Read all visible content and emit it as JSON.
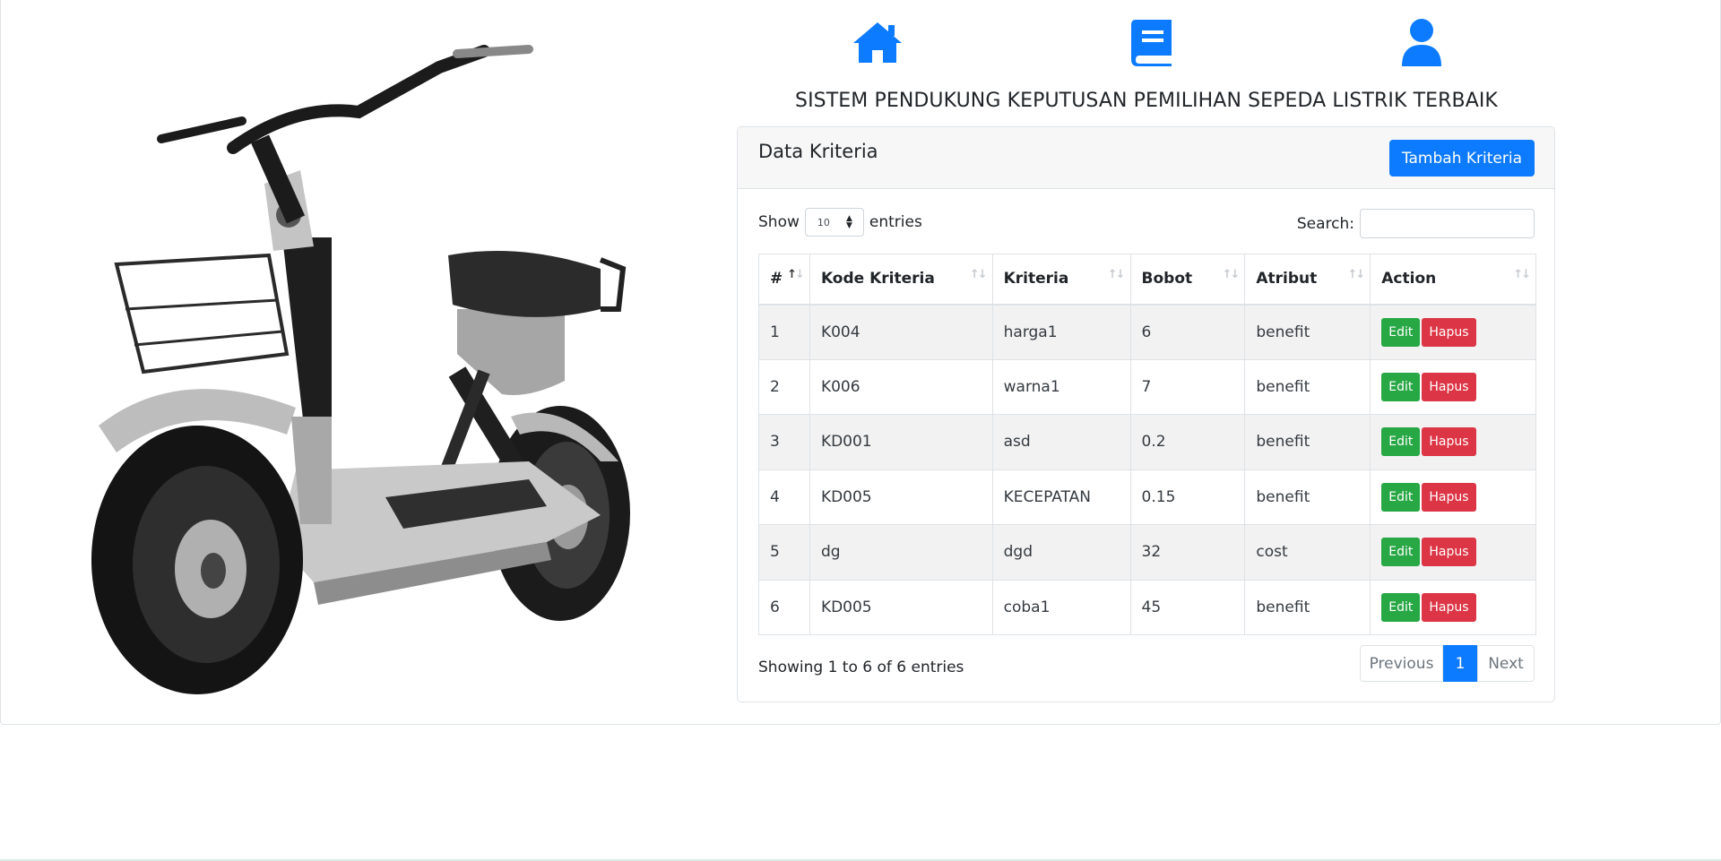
{
  "app": {
    "title": "SISTEM PENDUKUNG KEPUTUSAN PEMILIHAN SEPEDA LISTRIK TERBAIK"
  },
  "nav": [
    {
      "icon": "home-icon"
    },
    {
      "icon": "book-icon"
    },
    {
      "icon": "user-icon"
    }
  ],
  "card": {
    "title": "Data Kriteria",
    "add_button": "Tambah Kriteria"
  },
  "controls": {
    "show_label": "Show",
    "entries_value": "10",
    "entries_label": "entries",
    "search_label": "Search:",
    "search_value": ""
  },
  "table": {
    "headers": [
      "#",
      "Kode Kriteria",
      "Kriteria",
      "Bobot",
      "Atribut",
      "Action"
    ],
    "rows": [
      {
        "no": "1",
        "kode": "K004",
        "kriteria": "harga1",
        "bobot": "6",
        "atribut": "benefit"
      },
      {
        "no": "2",
        "kode": "K006",
        "kriteria": "warna1",
        "bobot": "7",
        "atribut": "benefit"
      },
      {
        "no": "3",
        "kode": "KD001",
        "kriteria": "asd",
        "bobot": "0.2",
        "atribut": "benefit"
      },
      {
        "no": "4",
        "kode": "KD005",
        "kriteria": "KECEPATAN",
        "bobot": "0.15",
        "atribut": "benefit"
      },
      {
        "no": "5",
        "kode": "dg",
        "kriteria": "dgd",
        "bobot": "32",
        "atribut": "cost"
      },
      {
        "no": "6",
        "kode": "KD005",
        "kriteria": "coba1",
        "bobot": "45",
        "atribut": "benefit"
      }
    ],
    "edit_label": "Edit",
    "delete_label": "Hapus"
  },
  "footer": {
    "info": "Showing 1 to 6 of 6 entries",
    "prev": "Previous",
    "page": "1",
    "next": "Next"
  },
  "colors": {
    "primary": "#0d7bff",
    "success": "#28a745",
    "danger": "#dc3545"
  }
}
